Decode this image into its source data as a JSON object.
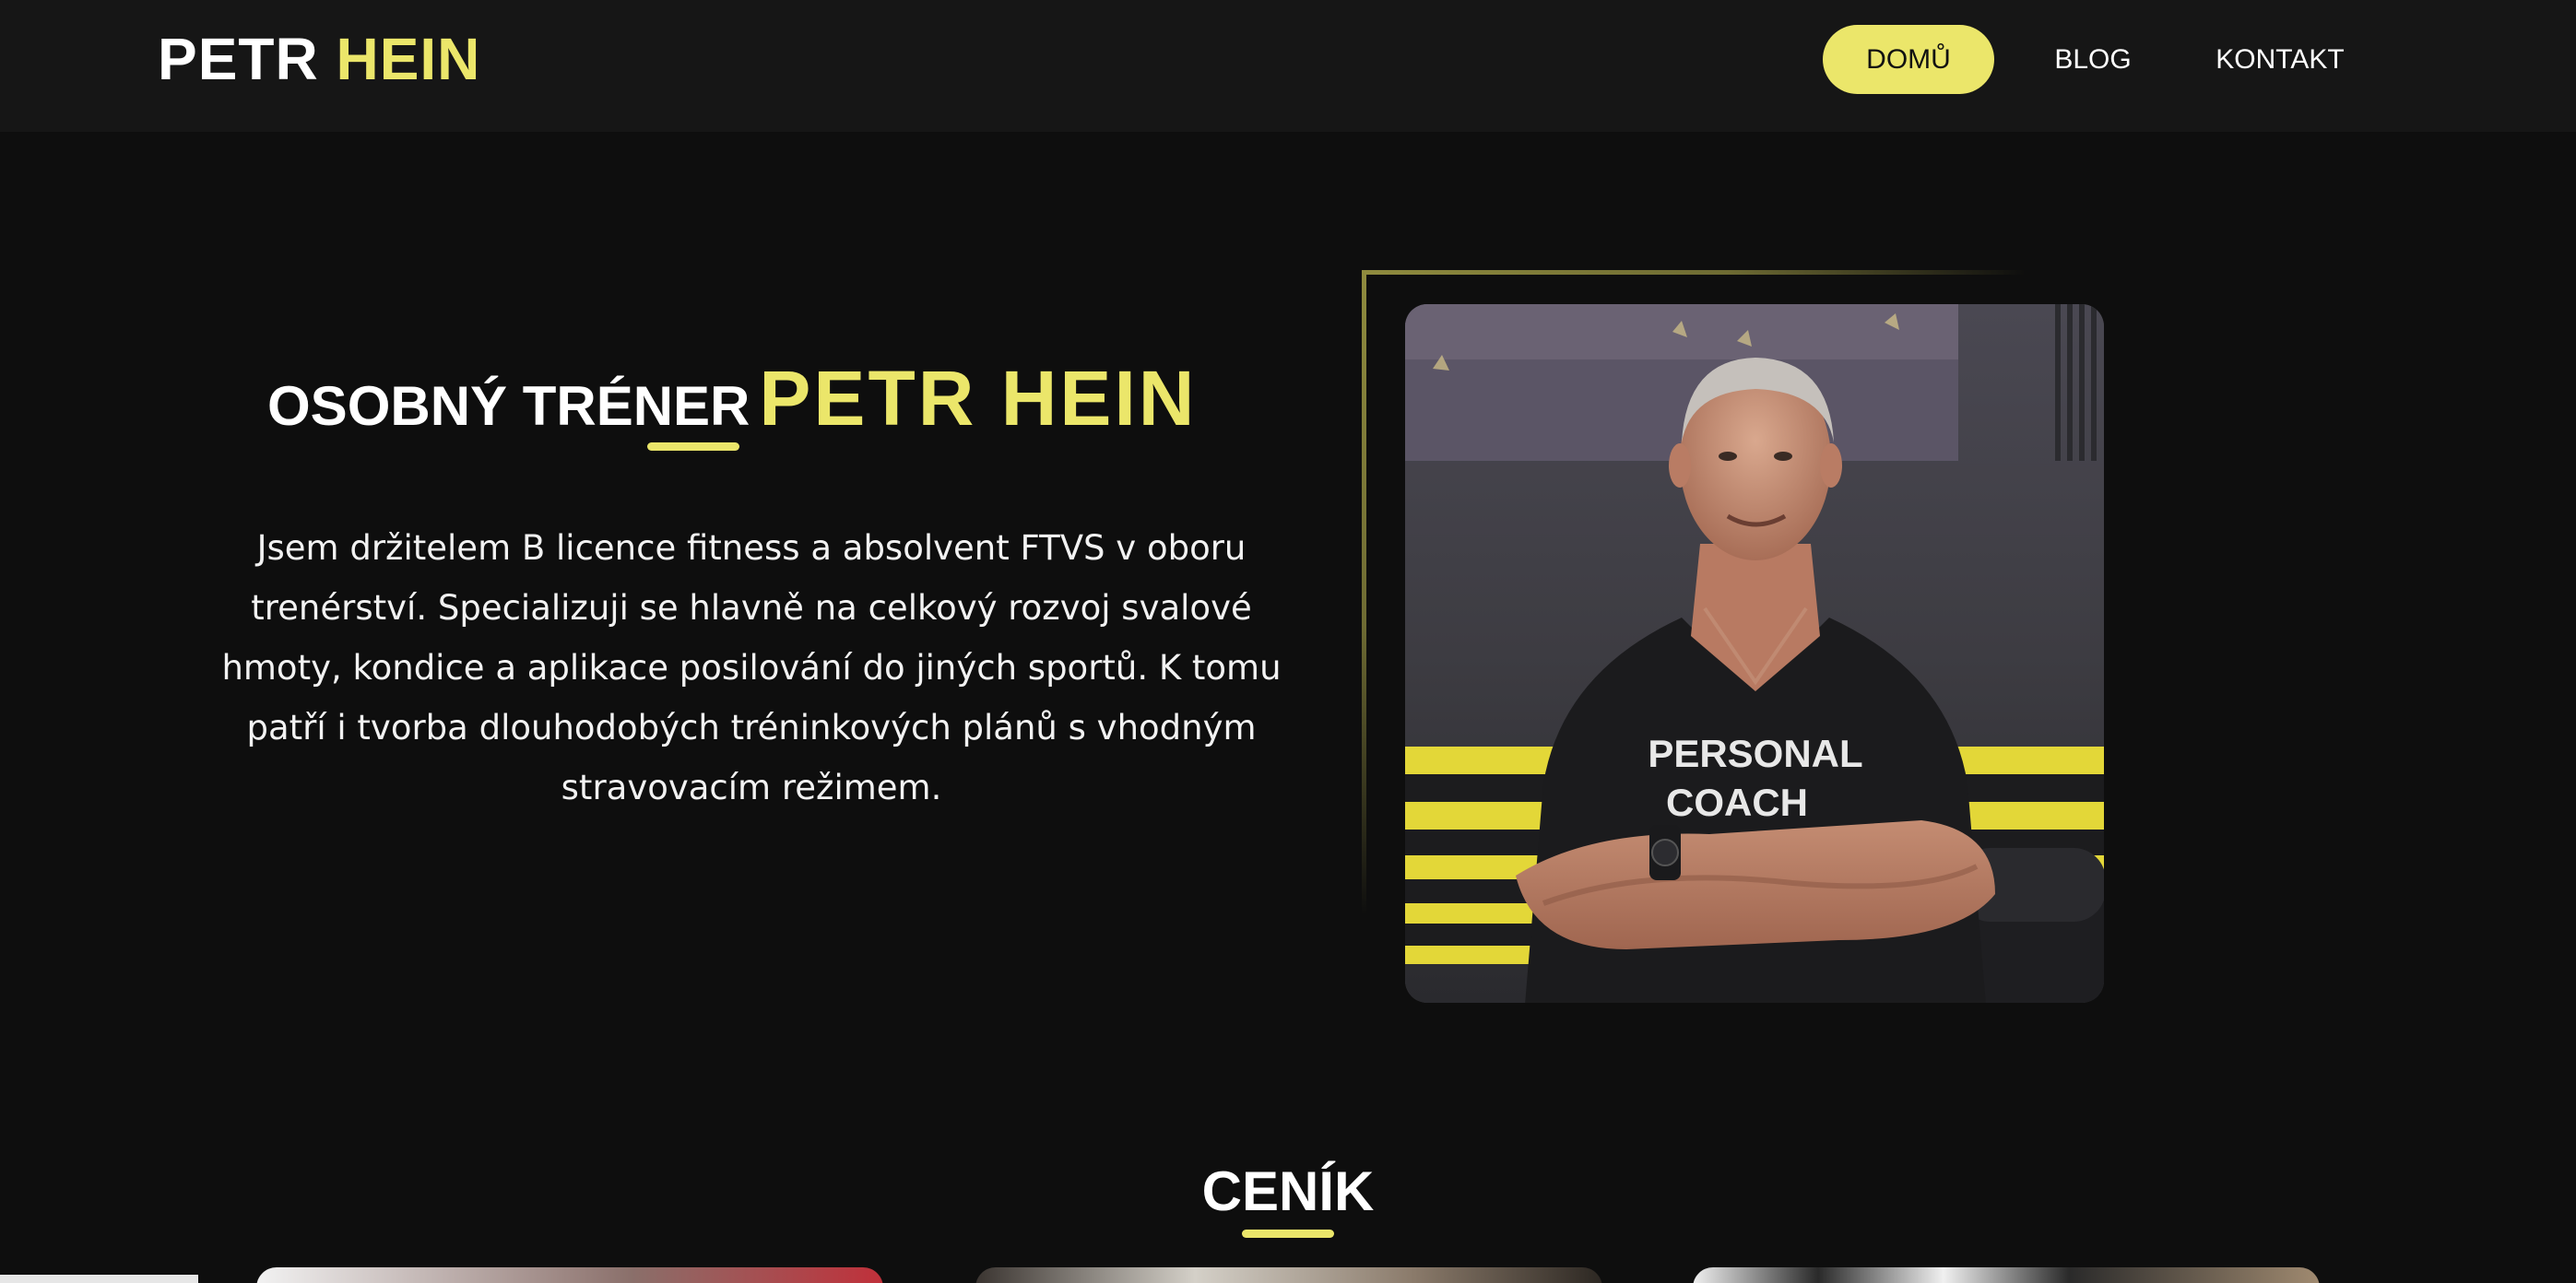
{
  "brand": {
    "first_name": "PETR",
    "last_name": "HEIN",
    "accent_color": "#ebe66a"
  },
  "nav": {
    "items": [
      {
        "label": "DOMŮ",
        "active": true
      },
      {
        "label": "BLOG",
        "active": false
      },
      {
        "label": "KONTAKT",
        "active": false
      }
    ]
  },
  "hero": {
    "title_prefix": "OSOBNÝ TRÉNER",
    "title_name": "PETR HEIN",
    "description": "Jsem držitelem B licence fitness a absolvent FTVS v oboru trenérství. Specializuji se hlavně na celkový rozvoj svalové hmoty, kondice a aplikace posilování do jiných sportů. K tomu patří i tvorba dlouhodobých tréninkových plánů s vhodným stravovacím režimem.",
    "photo": {
      "shirt_text_line1": "PERSONAL",
      "shirt_text_line2": "COACH"
    }
  },
  "pricing": {
    "title": "CENÍK"
  }
}
